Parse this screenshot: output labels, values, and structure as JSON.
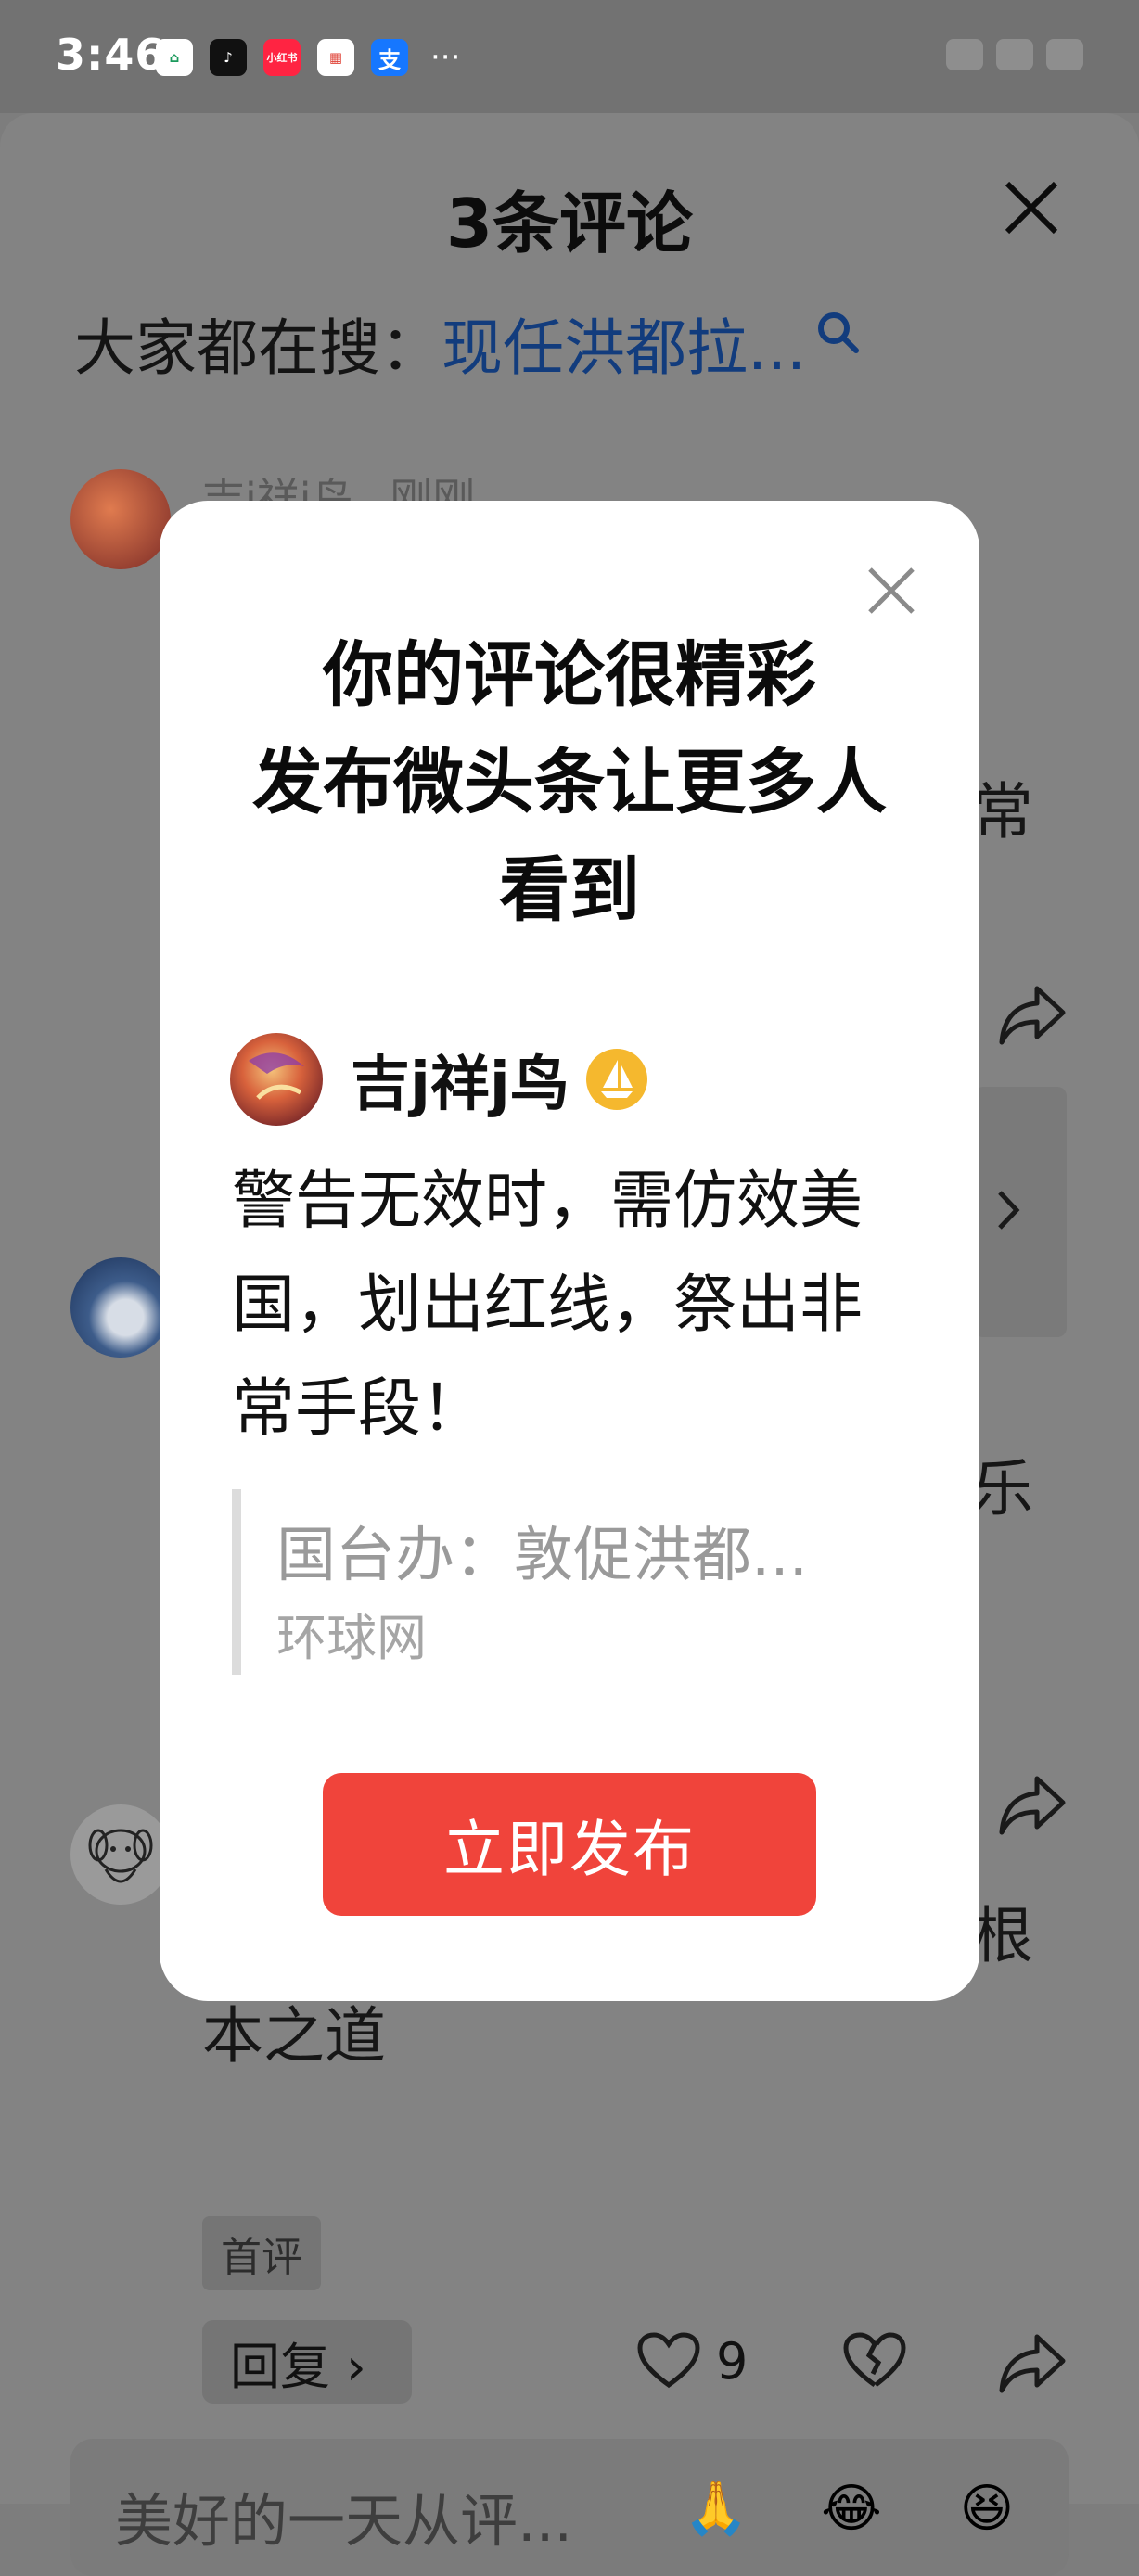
{
  "status_bar": {
    "time": "3:46",
    "apps": [
      {
        "name": "home-app-icon",
        "text": "⌂",
        "color": "#ffffff"
      },
      {
        "name": "tiktok-icon",
        "text": "♪",
        "color": "#111111"
      },
      {
        "name": "xiaohongshu-icon",
        "text": "小红书",
        "color": "#ff2442"
      },
      {
        "name": "mall-app-icon",
        "text": "▦",
        "color": "#ffffff"
      },
      {
        "name": "alipay-icon",
        "text": "支",
        "color": "#1677ff"
      }
    ],
    "more": "···"
  },
  "sheet": {
    "title": "3条评论",
    "hot_search_label": "大家都在搜：",
    "hot_search_term": "现任洪都拉..."
  },
  "background_comments": {
    "first_author": "吉j祥j鸟",
    "first_time": "刚刚",
    "first_text_tail": "常",
    "second_text_tail": "乐",
    "third_text_tail": "根",
    "third_text_line2": "本之道",
    "tag": "首评",
    "reply_label": "回复 ›",
    "like_count": "9"
  },
  "composer": {
    "placeholder": "美好的一天从评...",
    "emojis": [
      "🙏",
      "😂",
      "😆"
    ]
  },
  "modal": {
    "headline_line1": "你的评论很精彩",
    "headline_line2": "发布微头条让更多人",
    "headline_line3": "看到",
    "username": "吉j祥j鸟",
    "comment_line1": "警告无效时，需仿效美",
    "comment_line2": "国，划出红线，祭出非",
    "comment_line3": "常手段！",
    "quote_title": "国台办：敦促洪都...",
    "quote_source": "环球网",
    "publish_label": "立即发布"
  },
  "colors": {
    "accent_red": "#f0443b",
    "link_blue": "#123c7d",
    "badge_gold": "#f5b82e"
  }
}
